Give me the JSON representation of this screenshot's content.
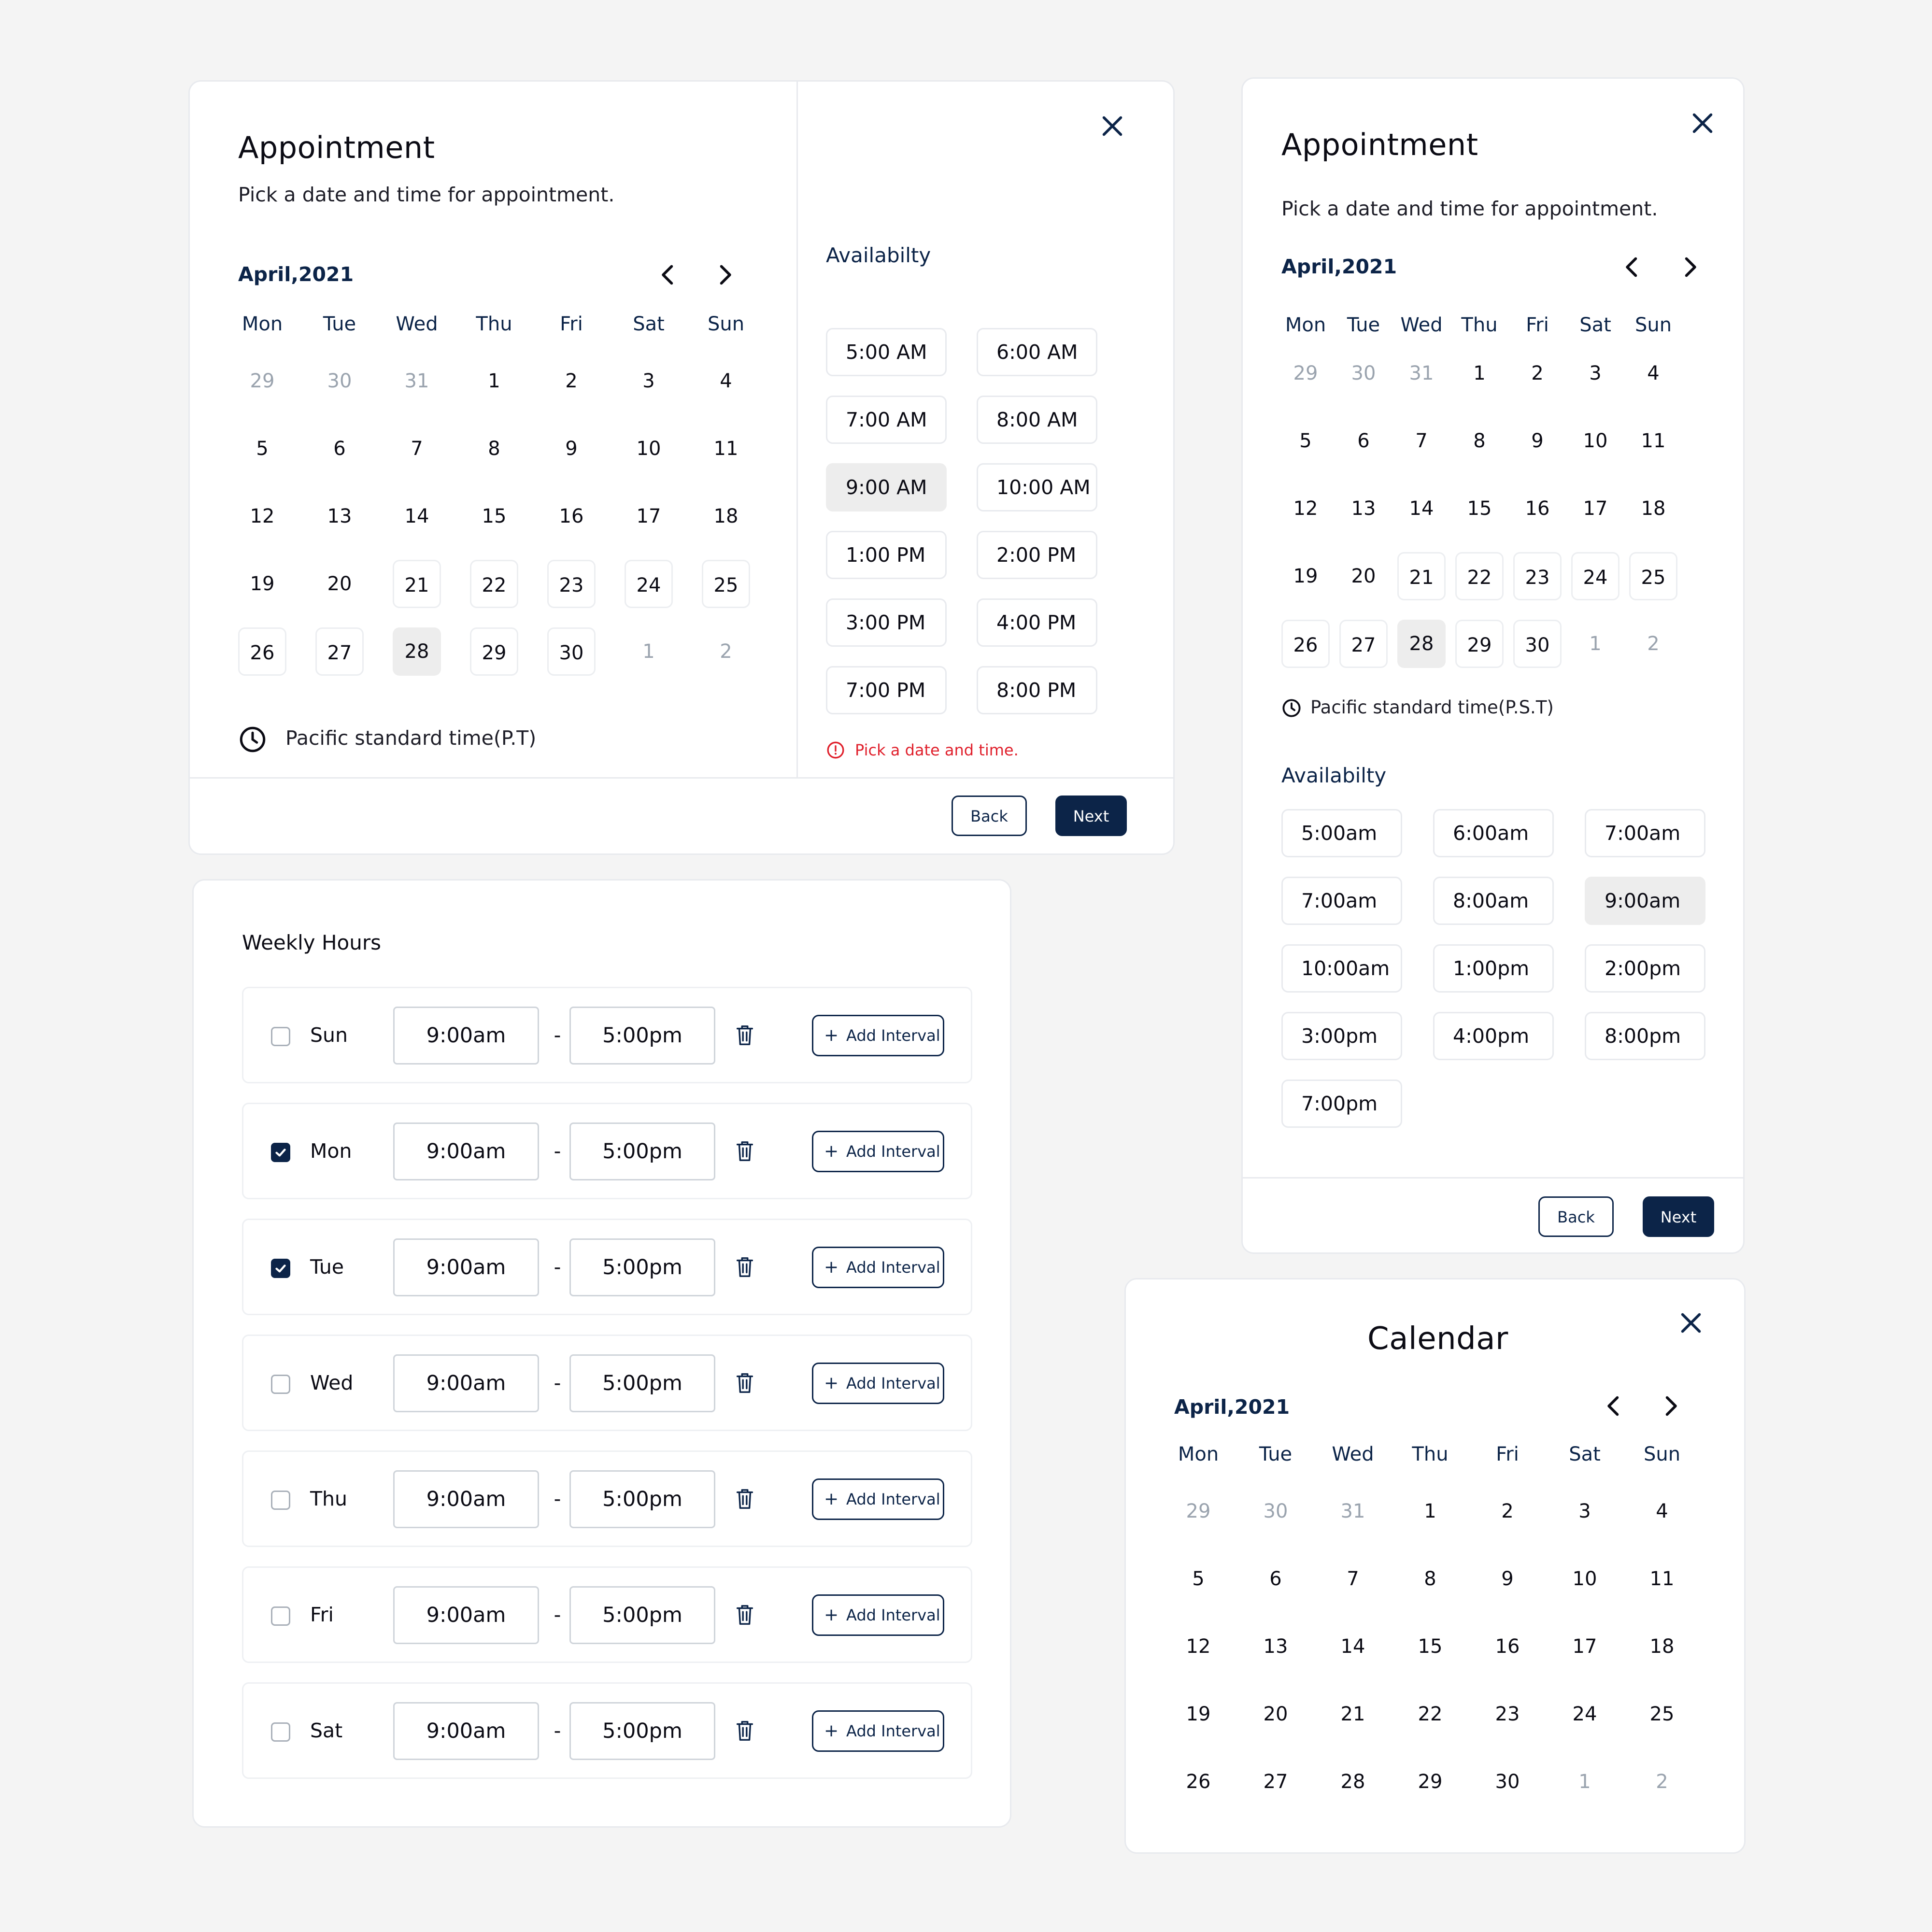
{
  "appointment1": {
    "title": "Appointment",
    "subtitle": "Pick a date and time for appointment.",
    "month": "April,2021",
    "weekdays": [
      "Mon",
      "Tue",
      "Wed",
      "Thu",
      "Fri",
      "Sat",
      "Sun"
    ],
    "days": [
      [
        "29",
        "30",
        "31",
        "1",
        "2",
        "3",
        "4"
      ],
      [
        "5",
        "6",
        "7",
        "8",
        "9",
        "10",
        "11"
      ],
      [
        "12",
        "13",
        "14",
        "15",
        "16",
        "17",
        "18"
      ],
      [
        "19",
        "20",
        "21",
        "22",
        "23",
        "24",
        "25"
      ],
      [
        "26",
        "27",
        "28",
        "29",
        "30",
        "1",
        "2"
      ]
    ],
    "timezone": "Pacific standard time(P.T)",
    "availability_title": "Availabilty",
    "slots": [
      "5:00 AM",
      "6:00 AM",
      "7:00 AM",
      "8:00 AM",
      "9:00 AM",
      "10:00 AM",
      "1:00 PM",
      "2:00 PM",
      "3:00 PM",
      "4:00 PM",
      "7:00 PM",
      "8:00 PM"
    ],
    "selected_slot": "9:00 AM",
    "selected_day": "28",
    "error": "Pick a date and time.",
    "back_label": "Back",
    "next_label": "Next"
  },
  "appointment2": {
    "title": "Appointment",
    "subtitle": "Pick a date and time for appointment.",
    "month": "April,2021",
    "weekdays": [
      "Mon",
      "Tue",
      "Wed",
      "Thu",
      "Fri",
      "Sat",
      "Sun"
    ],
    "days": [
      [
        "29",
        "30",
        "31",
        "1",
        "2",
        "3",
        "4"
      ],
      [
        "5",
        "6",
        "7",
        "8",
        "9",
        "10",
        "11"
      ],
      [
        "12",
        "13",
        "14",
        "15",
        "16",
        "17",
        "18"
      ],
      [
        "19",
        "20",
        "21",
        "22",
        "23",
        "24",
        "25"
      ],
      [
        "26",
        "27",
        "28",
        "29",
        "30",
        "1",
        "2"
      ]
    ],
    "timezone": "Pacific standard time(P.S.T)",
    "availability_title": "Availabilty",
    "slots": [
      "5:00am",
      "6:00am",
      "7:00am",
      "7:00am",
      "8:00am",
      "9:00am",
      "10:00am",
      "1:00pm",
      "2:00pm",
      "3:00pm",
      "4:00pm",
      "8:00pm",
      "7:00pm"
    ],
    "selected_slot": "9:00am",
    "selected_day": "28",
    "back_label": "Back",
    "next_label": "Next"
  },
  "weekly_hours": {
    "title": "Weekly Hours",
    "add_label": "Add Interval",
    "rows": [
      {
        "day": "Sun",
        "checked": false,
        "from": "9:00am",
        "dash": "-",
        "to": "5:00pm"
      },
      {
        "day": "Mon",
        "checked": true,
        "from": "9:00am",
        "dash": "-",
        "to": "5:00pm"
      },
      {
        "day": "Tue",
        "checked": true,
        "from": "9:00am",
        "dash": "-",
        "to": "5:00pm"
      },
      {
        "day": "Wed",
        "checked": false,
        "from": "9:00am",
        "dash": "-",
        "to": "5:00pm"
      },
      {
        "day": "Thu",
        "checked": false,
        "from": "9:00am",
        "dash": "-",
        "to": "5:00pm"
      },
      {
        "day": "Fri",
        "checked": false,
        "from": "9:00am",
        "dash": "-",
        "to": "5:00pm"
      },
      {
        "day": "Sat",
        "checked": false,
        "from": "9:00am",
        "dash": "-",
        "to": "5:00pm"
      }
    ]
  },
  "calendar": {
    "title": "Calendar",
    "month": "April,2021",
    "weekdays": [
      "Mon",
      "Tue",
      "Wed",
      "Thu",
      "Fri",
      "Sat",
      "Sun"
    ],
    "days": [
      [
        "29",
        "30",
        "31",
        "1",
        "2",
        "3",
        "4"
      ],
      [
        "5",
        "6",
        "7",
        "8",
        "9",
        "10",
        "11"
      ],
      [
        "12",
        "13",
        "14",
        "15",
        "16",
        "17",
        "18"
      ],
      [
        "19",
        "20",
        "21",
        "22",
        "23",
        "24",
        "25"
      ],
      [
        "26",
        "27",
        "28",
        "29",
        "30",
        "1",
        "2"
      ]
    ]
  },
  "colors": {
    "navy": "#0c2448",
    "muted": "#9aa3ae",
    "selected_bg": "#ededed",
    "error": "#e0202c",
    "page_bg": "#f4f4f4"
  },
  "icons": {
    "close": "close-icon",
    "prev": "chevron-left-icon",
    "next": "chevron-right-icon",
    "clock": "clock-icon",
    "alert": "alert-circle-icon",
    "check": "check-icon",
    "trash": "trash-icon",
    "plus": "plus-icon"
  }
}
